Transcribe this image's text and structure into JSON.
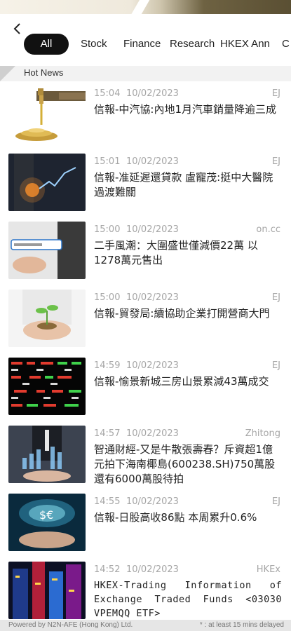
{
  "nav": {
    "back_icon": "chevron-left-icon",
    "tabs": [
      {
        "label": "All",
        "active": true
      },
      {
        "label": "Stock",
        "active": false
      },
      {
        "label": "Finance",
        "active": false
      },
      {
        "label": "Research",
        "active": false
      },
      {
        "label": "HKEX Ann",
        "active": false
      },
      {
        "label": "C",
        "active": false
      }
    ]
  },
  "section": {
    "title": "Hot News"
  },
  "news": [
    {
      "time": "15:04",
      "date": "10/02/2023",
      "source": "EJ",
      "title": "信報-中汽協:內地1月汽車銷量降逾三成",
      "thumb": "faucet-coins-image"
    },
    {
      "time": "15:01",
      "date": "10/02/2023",
      "source": "EJ",
      "title": "信報-准延遲還貸款 盧寵茂:挺中大醫院過渡難關",
      "thumb": "business-chart-image"
    },
    {
      "time": "15:00",
      "date": "10/02/2023",
      "source": "on.cc",
      "title": "二手風潮：大圍盛世僅減價22萬 以1278萬元售出",
      "thumb": "search-bar-image"
    },
    {
      "time": "15:00",
      "date": "10/02/2023",
      "source": "EJ",
      "title": "信報-貿發局:續協助企業打開營商大門",
      "thumb": "plant-hands-image"
    },
    {
      "time": "14:59",
      "date": "10/02/2023",
      "source": "EJ",
      "title": "信報-愉景新城三房山景累減43萬成交",
      "thumb": "stock-board-image"
    },
    {
      "time": "14:57",
      "date": "10/02/2023",
      "source": "Zhitong",
      "title": "智通財經-又是牛散張壽春？斥資超1億元拍下海南椰島(600238.SH)750萬股 還有6000萬股待拍",
      "thumb": "businessman-chart-image"
    },
    {
      "time": "14:55",
      "date": "10/02/2023",
      "source": "EJ",
      "title": "信報-日股高收86點 本周累升0.6%",
      "thumb": "currency-globe-image"
    },
    {
      "time": "14:52",
      "date": "10/02/2023",
      "source": "HKEx",
      "title": "HKEX-Trading Information of Exchange Traded Funds <03030 VPEMQQ ETF>",
      "thumb": "neon-city-image"
    }
  ],
  "footer": {
    "left": "Powered by N2N-AFE (Hong Kong) Ltd.",
    "right": "* : at least 15 mins delayed"
  },
  "colors": {
    "active_tab_bg": "#111111",
    "meta_gray": "#a6a6a6",
    "divider": "#d4d4d4"
  }
}
